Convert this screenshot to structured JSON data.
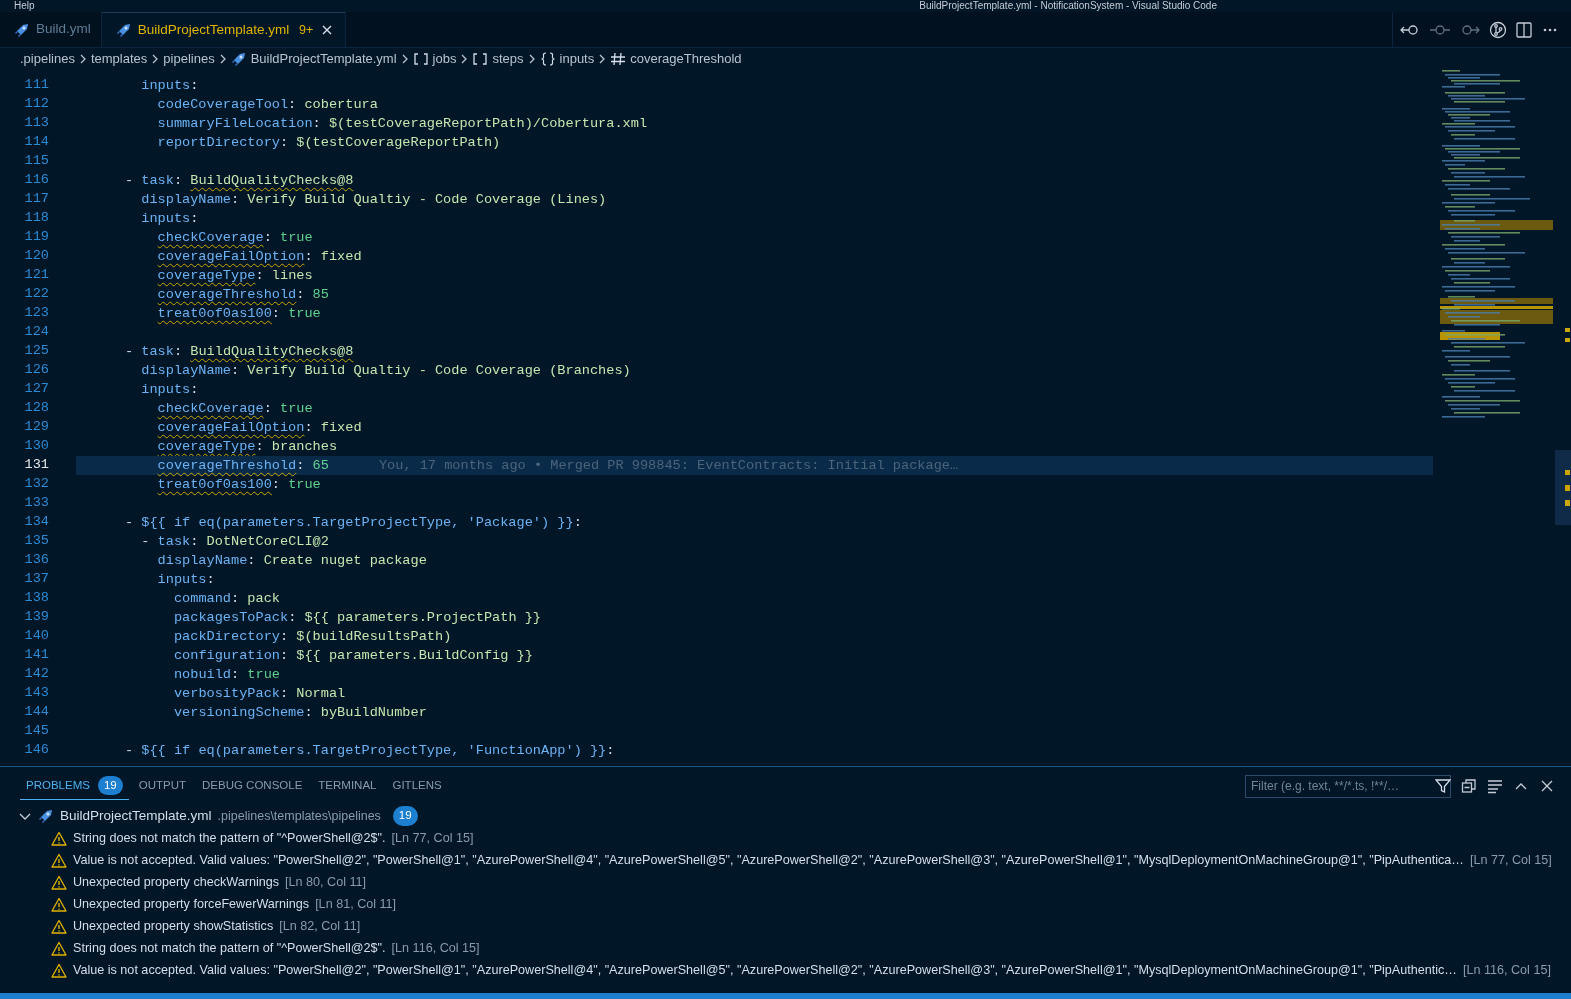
{
  "title_bar": {
    "menu": "Help",
    "title": "BuildProjectTemplate.yml - NotificationSystem - Visual Studio Code"
  },
  "tabs": [
    {
      "label": "Build.yml",
      "selected": false
    },
    {
      "label": "BuildProjectTemplate.yml",
      "selected": true,
      "badge": "9+"
    }
  ],
  "breadcrumbs": [
    {
      "kind": "folder",
      "label": ".pipelines"
    },
    {
      "kind": "folder",
      "label": "templates"
    },
    {
      "kind": "folder",
      "label": "pipelines"
    },
    {
      "kind": "file",
      "label": "BuildProjectTemplate.yml"
    },
    {
      "kind": "array",
      "label": "jobs"
    },
    {
      "kind": "array",
      "label": "steps"
    },
    {
      "kind": "object",
      "label": "inputs"
    },
    {
      "kind": "number",
      "label": "coverageThreshold"
    }
  ],
  "code_lines": [
    {
      "number": "111",
      "current": false,
      "tokens": [
        {
          "kind": "key",
          "text": "        inputs"
        },
        {
          "kind": "punct",
          "text": ":"
        }
      ]
    },
    {
      "number": "112",
      "current": false,
      "tokens": [
        {
          "kind": "key",
          "text": "          codeCoverageTool"
        },
        {
          "kind": "punct",
          "text": ": "
        },
        {
          "kind": "string",
          "text": "cobertura"
        }
      ]
    },
    {
      "number": "113",
      "current": false,
      "tokens": [
        {
          "kind": "key",
          "text": "          summaryFileLocation"
        },
        {
          "kind": "punct",
          "text": ": "
        },
        {
          "kind": "string",
          "text": "$(testCoverageReportPath)/Cobertura.xml"
        }
      ]
    },
    {
      "number": "114",
      "current": false,
      "tokens": [
        {
          "kind": "key",
          "text": "          reportDirectory"
        },
        {
          "kind": "punct",
          "text": ": "
        },
        {
          "kind": "string",
          "text": "$(testCoverageReportPath)"
        }
      ]
    },
    {
      "number": "115",
      "current": false
    },
    {
      "number": "116",
      "current": false,
      "tokens": [
        {
          "kind": "punct",
          "text": "      - "
        },
        {
          "kind": "key",
          "text": "task"
        },
        {
          "kind": "punct",
          "text": ": "
        },
        {
          "kind": "string",
          "text": "BuildQualityChecks@8",
          "warning": true
        }
      ]
    },
    {
      "number": "117",
      "current": false,
      "tokens": [
        {
          "kind": "key",
          "text": "        displayName"
        },
        {
          "kind": "punct",
          "text": ": "
        },
        {
          "kind": "string",
          "text": "Verify Build Qualtiy - Code Coverage (Lines)"
        }
      ]
    },
    {
      "number": "118",
      "current": false,
      "tokens": [
        {
          "kind": "key",
          "text": "        inputs"
        },
        {
          "kind": "punct",
          "text": ":"
        }
      ]
    },
    {
      "number": "119",
      "current": false,
      "tokens": [
        {
          "kind": "key",
          "text": "          checkCoverage",
          "warning": true
        },
        {
          "kind": "punct",
          "text": ": "
        },
        {
          "kind": "literal",
          "text": "true"
        }
      ]
    },
    {
      "number": "120",
      "current": false,
      "tokens": [
        {
          "kind": "key",
          "text": "          coverageFailOption",
          "warning": true
        },
        {
          "kind": "punct",
          "text": ": "
        },
        {
          "kind": "string",
          "text": "fixed"
        }
      ]
    },
    {
      "number": "121",
      "current": false,
      "tokens": [
        {
          "kind": "key",
          "text": "          coverageType",
          "warning": true
        },
        {
          "kind": "punct",
          "text": ": "
        },
        {
          "kind": "string",
          "text": "lines"
        }
      ]
    },
    {
      "number": "122",
      "current": false,
      "tokens": [
        {
          "kind": "key",
          "text": "          coverageThreshold",
          "warning": true
        },
        {
          "kind": "punct",
          "text": ": "
        },
        {
          "kind": "literal",
          "text": "85"
        }
      ]
    },
    {
      "number": "123",
      "current": false,
      "tokens": [
        {
          "kind": "key",
          "text": "          treat0of0as100",
          "warning": true
        },
        {
          "kind": "punct",
          "text": ": "
        },
        {
          "kind": "literal",
          "text": "true"
        }
      ]
    },
    {
      "number": "124",
      "current": false
    },
    {
      "number": "125",
      "current": false,
      "tokens": [
        {
          "kind": "punct",
          "text": "      - "
        },
        {
          "kind": "key",
          "text": "task"
        },
        {
          "kind": "punct",
          "text": ": "
        },
        {
          "kind": "string",
          "text": "BuildQualityChecks@8",
          "warning": true
        }
      ]
    },
    {
      "number": "126",
      "current": false,
      "tokens": [
        {
          "kind": "key",
          "text": "        displayName"
        },
        {
          "kind": "punct",
          "text": ": "
        },
        {
          "kind": "string",
          "text": "Verify Build Qualtiy - Code Coverage (Branches)"
        }
      ]
    },
    {
      "number": "127",
      "current": false,
      "tokens": [
        {
          "kind": "key",
          "text": "        inputs"
        },
        {
          "kind": "punct",
          "text": ":"
        }
      ]
    },
    {
      "number": "128",
      "current": false,
      "tokens": [
        {
          "kind": "key",
          "text": "          checkCoverage",
          "warning": true
        },
        {
          "kind": "punct",
          "text": ": "
        },
        {
          "kind": "literal",
          "text": "true"
        }
      ]
    },
    {
      "number": "129",
      "current": false,
      "tokens": [
        {
          "kind": "key",
          "text": "          coverageFailOption",
          "warning": true
        },
        {
          "kind": "punct",
          "text": ": "
        },
        {
          "kind": "string",
          "text": "fixed"
        }
      ]
    },
    {
      "number": "130",
      "current": false,
      "tokens": [
        {
          "kind": "key",
          "text": "          coverageType",
          "warning": true
        },
        {
          "kind": "punct",
          "text": ": "
        },
        {
          "kind": "string",
          "text": "branches"
        }
      ]
    },
    {
      "number": "131",
      "current": true,
      "blame": "You, 17 months ago • Merged PR 998845: EventContracts: Initial package…",
      "tokens": [
        {
          "kind": "key",
          "text": "          coverageThreshold",
          "warning": true
        },
        {
          "kind": "punct",
          "text": ": "
        },
        {
          "kind": "literal",
          "text": "65"
        }
      ]
    },
    {
      "number": "132",
      "current": false,
      "tokens": [
        {
          "kind": "key",
          "text": "          treat0of0as100",
          "warning": true
        },
        {
          "kind": "punct",
          "text": ": "
        },
        {
          "kind": "literal",
          "text": "true"
        }
      ]
    },
    {
      "number": "133",
      "current": false
    },
    {
      "number": "134",
      "current": false,
      "tokens": [
        {
          "kind": "punct",
          "text": "      - "
        },
        {
          "kind": "key",
          "text": "${{ if eq(parameters.TargetProjectType, 'Package') }}"
        },
        {
          "kind": "punct",
          "text": ":"
        }
      ]
    },
    {
      "number": "135",
      "current": false,
      "tokens": [
        {
          "kind": "punct",
          "text": "        - "
        },
        {
          "kind": "key",
          "text": "task"
        },
        {
          "kind": "punct",
          "text": ": "
        },
        {
          "kind": "string",
          "text": "DotNetCoreCLI@2"
        }
      ]
    },
    {
      "number": "136",
      "current": false,
      "tokens": [
        {
          "kind": "key",
          "text": "          displayName"
        },
        {
          "kind": "punct",
          "text": ": "
        },
        {
          "kind": "string",
          "text": "Create nuget package"
        }
      ]
    },
    {
      "number": "137",
      "current": false,
      "tokens": [
        {
          "kind": "key",
          "text": "          inputs"
        },
        {
          "kind": "punct",
          "text": ":"
        }
      ]
    },
    {
      "number": "138",
      "current": false,
      "tokens": [
        {
          "kind": "key",
          "text": "            command"
        },
        {
          "kind": "punct",
          "text": ": "
        },
        {
          "kind": "string",
          "text": "pack"
        }
      ]
    },
    {
      "number": "139",
      "current": false,
      "tokens": [
        {
          "kind": "key",
          "text": "            packagesToPack"
        },
        {
          "kind": "punct",
          "text": ": "
        },
        {
          "kind": "string",
          "text": "${{ parameters.ProjectPath }}"
        }
      ]
    },
    {
      "number": "140",
      "current": false,
      "tokens": [
        {
          "kind": "key",
          "text": "            packDirectory"
        },
        {
          "kind": "punct",
          "text": ": "
        },
        {
          "kind": "string",
          "text": "$(buildResultsPath)"
        }
      ]
    },
    {
      "number": "141",
      "current": false,
      "tokens": [
        {
          "kind": "key",
          "text": "            configuration"
        },
        {
          "kind": "punct",
          "text": ": "
        },
        {
          "kind": "string",
          "text": "${{ parameters.BuildConfig }}"
        }
      ]
    },
    {
      "number": "142",
      "current": false,
      "tokens": [
        {
          "kind": "key",
          "text": "            nobuild"
        },
        {
          "kind": "punct",
          "text": ": "
        },
        {
          "kind": "literal",
          "text": "true"
        }
      ]
    },
    {
      "number": "143",
      "current": false,
      "tokens": [
        {
          "kind": "key",
          "text": "            verbosityPack"
        },
        {
          "kind": "punct",
          "text": ": "
        },
        {
          "kind": "string",
          "text": "Normal"
        }
      ]
    },
    {
      "number": "144",
      "current": false,
      "tokens": [
        {
          "kind": "key",
          "text": "            versioningScheme"
        },
        {
          "kind": "punct",
          "text": ": "
        },
        {
          "kind": "string",
          "text": "byBuildNumber"
        }
      ]
    },
    {
      "number": "145",
      "current": false
    },
    {
      "number": "146",
      "current": false,
      "tokens": [
        {
          "kind": "punct",
          "text": "      - "
        },
        {
          "kind": "key",
          "text": "${{ if eq(parameters.TargetProjectType, 'FunctionApp') }}"
        },
        {
          "kind": "punct",
          "text": ":"
        }
      ]
    }
  ],
  "panel": {
    "tabs": [
      {
        "label": "PROBLEMS",
        "selected": true,
        "badge": "19"
      },
      {
        "label": "OUTPUT",
        "selected": false
      },
      {
        "label": "DEBUG CONSOLE",
        "selected": false
      },
      {
        "label": "TERMINAL",
        "selected": false
      },
      {
        "label": "GITLENS",
        "selected": false
      }
    ],
    "filter": {
      "placeholder": "Filter (e.g. text, **/*.ts, !**/…"
    },
    "file": {
      "name": "BuildProjectTemplate.yml",
      "path": ".pipelines\\templates\\pipelines",
      "count": "19",
      "expanded": true
    },
    "problems": [
      {
        "message": "String does not match the pattern of \"^PowerShell@2$\".",
        "location": "[Ln 77, Col 15]"
      },
      {
        "message": "Value is not accepted. Valid values: \"PowerShell@2\", \"PowerShell@1\", \"AzurePowerShell@4\", \"AzurePowerShell@5\", \"AzurePowerShell@2\", \"AzurePowerShell@3\", \"AzurePowerShell@1\", \"MysqlDeploymentOnMachineGroup@1\", \"PipAuthentica…",
        "location": "[Ln 77, Col 15]"
      },
      {
        "message": "Unexpected property checkWarnings",
        "location": "[Ln 80, Col 11]"
      },
      {
        "message": "Unexpected property forceFewerWarnings",
        "location": "[Ln 81, Col 11]"
      },
      {
        "message": "Unexpected property showStatistics",
        "location": "[Ln 82, Col 11]"
      },
      {
        "message": "String does not match the pattern of \"^PowerShell@2$\".",
        "location": "[Ln 116, Col 15]"
      },
      {
        "message": "Value is not accepted. Valid values: \"PowerShell@2\", \"PowerShell@1\", \"AzurePowerShell@4\", \"AzurePowerShell@5\", \"AzurePowerShell@2\", \"AzurePowerShell@3\", \"AzurePowerShell@1\", \"MysqlDeploymentOnMachineGroup@1\", \"PipAuthentic…",
        "location": "[Ln 116, Col 15]"
      }
    ]
  }
}
